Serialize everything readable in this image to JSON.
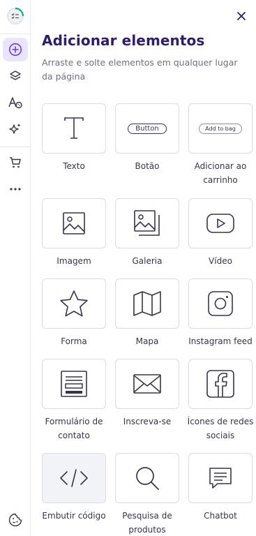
{
  "sidebar": {
    "items": [
      {
        "name": "progress-checklist-icon"
      },
      {
        "name": "add-circle-icon",
        "active": true
      },
      {
        "name": "layers-icon"
      },
      {
        "name": "text-style-icon"
      },
      {
        "name": "ai-sparkles-icon"
      },
      {
        "name": "cart-icon"
      },
      {
        "name": "more-dots-icon"
      },
      {
        "name": "cookie-icon"
      }
    ]
  },
  "panel": {
    "title": "Adicionar elementos",
    "subtitle": "Arraste e solte elementos em qualquer lugar da página",
    "close_icon": "close-icon"
  },
  "elements": [
    {
      "label": "Texto",
      "icon": "text-icon"
    },
    {
      "label": "Botão",
      "icon": "button-icon",
      "preview": "Button"
    },
    {
      "label": "Adicionar ao carrinho",
      "icon": "add-to-bag-icon",
      "preview": "Add to bag"
    },
    {
      "label": "Imagem",
      "icon": "image-icon"
    },
    {
      "label": "Galeria",
      "icon": "gallery-icon"
    },
    {
      "label": "Vídeo",
      "icon": "video-icon"
    },
    {
      "label": "Forma",
      "icon": "star-icon"
    },
    {
      "label": "Mapa",
      "icon": "map-icon"
    },
    {
      "label": "Instagram feed",
      "icon": "instagram-icon"
    },
    {
      "label": "Formulário de contato",
      "icon": "form-icon"
    },
    {
      "label": "Inscreva-se",
      "icon": "envelope-icon"
    },
    {
      "label": "Ícones de redes sociais",
      "icon": "facebook-icon"
    },
    {
      "label": "Embutir código",
      "icon": "code-icon",
      "highlight": true
    },
    {
      "label": "Pesquisa de produtos",
      "icon": "search-icon"
    },
    {
      "label": "Chatbot",
      "icon": "chat-icon"
    }
  ],
  "colors": {
    "accent": "#673de6",
    "accent_bg": "#ebe4ff",
    "title": "#2f1c6a",
    "text": "#36344d",
    "muted": "#6d7081",
    "border": "#dadce0",
    "progress": "#00b090"
  }
}
